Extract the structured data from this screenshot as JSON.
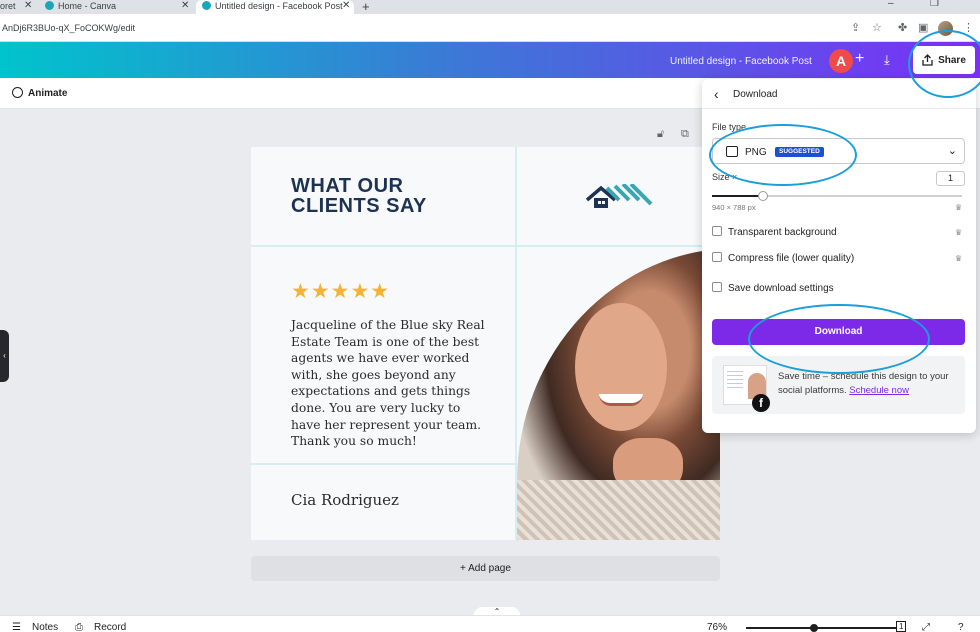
{
  "browser": {
    "tabs": [
      {
        "label": "oret"
      },
      {
        "label": "Home - Canva"
      },
      {
        "label": "Untitled design - Facebook Post"
      }
    ],
    "url": "AnDj6R3BUo-qX_FoCOKWg/edit"
  },
  "header": {
    "doc_title": "Untitled design - Facebook Post",
    "avatar_letter": "A",
    "share_label": "Share"
  },
  "toolbar": {
    "animate_label": "Animate"
  },
  "design": {
    "headline": "WHAT OUR CLIENTS SAY",
    "stars": "★★★★★",
    "testimonial": "Jacqueline of the Blue sky Real Estate Team is one of the best agents we have ever worked with, she goes beyond any expectations and gets things done. You are very lucky to have her represent your team. Thank you so much!",
    "client_name": "Cia Rodriguez"
  },
  "add_page_label": "+ Add page",
  "download_panel": {
    "title": "Download",
    "file_type_label": "File type",
    "file_type_value": "PNG",
    "suggested_badge": "SUGGESTED",
    "size_label": "Size ×",
    "size_value": "1",
    "dimensions": "940 × 788 px",
    "size_fraction": 0.2,
    "options": [
      {
        "label": "Transparent background"
      },
      {
        "label": "Compress file (lower quality)"
      },
      {
        "label": "Save download settings"
      }
    ],
    "download_button": "Download",
    "promo_text": "Save time – schedule this design to your social platforms.",
    "promo_link": "Schedule now"
  },
  "bottombar": {
    "notes_label": "Notes",
    "record_label": "Record",
    "zoom": "76%",
    "page_number": "1"
  },
  "colors": {
    "accent_purple": "#7d2ae8",
    "annotation_blue": "#1a9fd9",
    "headline_navy": "#1e3354",
    "star_gold": "#f5b335"
  }
}
